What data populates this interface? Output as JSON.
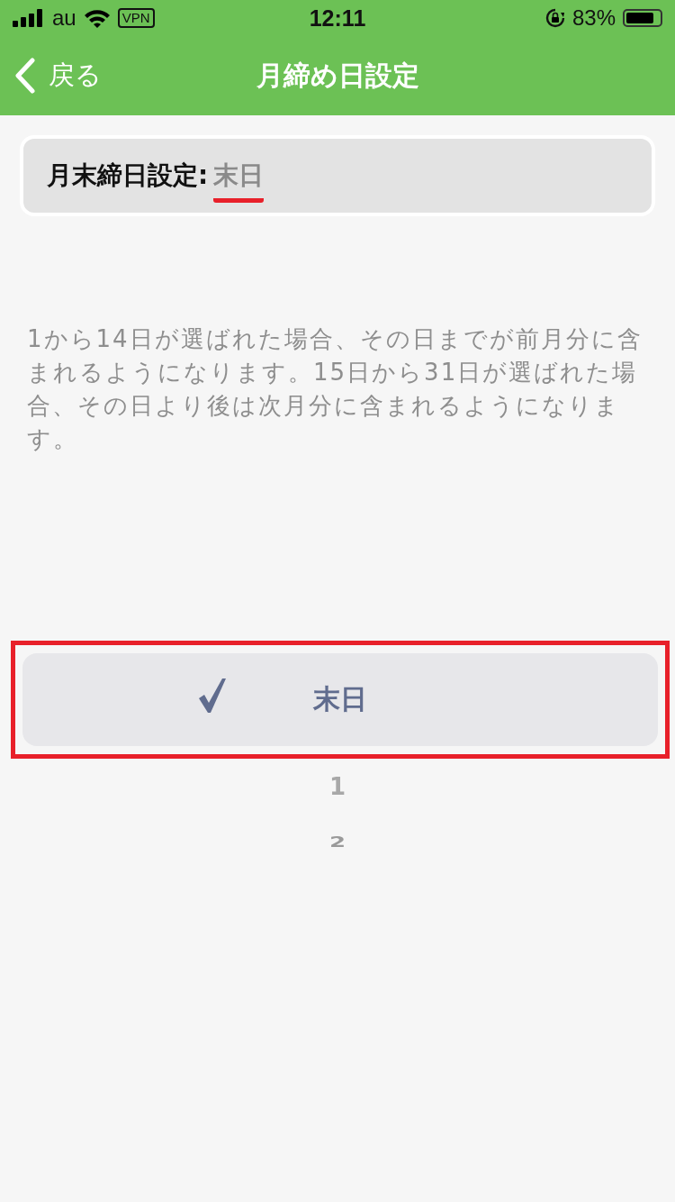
{
  "status_bar": {
    "carrier": "au",
    "vpn": "VPN",
    "time": "12:11",
    "battery": "83%"
  },
  "nav_bar": {
    "back": "戻る",
    "title": "月締め日設定"
  },
  "setting": {
    "label": "月末締日設定:",
    "value": "末日",
    "underlined": true
  },
  "description": "1から14日が選ばれた場合、その日までが前月分に含まれるようになります。15日から31日が選ばれた場合、その日より後は次月分に含まれるようになります。",
  "picker": {
    "highlighted": true,
    "options": [
      {
        "label": "末日",
        "selected": true
      },
      {
        "label": "1",
        "selected": false
      },
      {
        "label": "2",
        "selected": false
      }
    ]
  }
}
